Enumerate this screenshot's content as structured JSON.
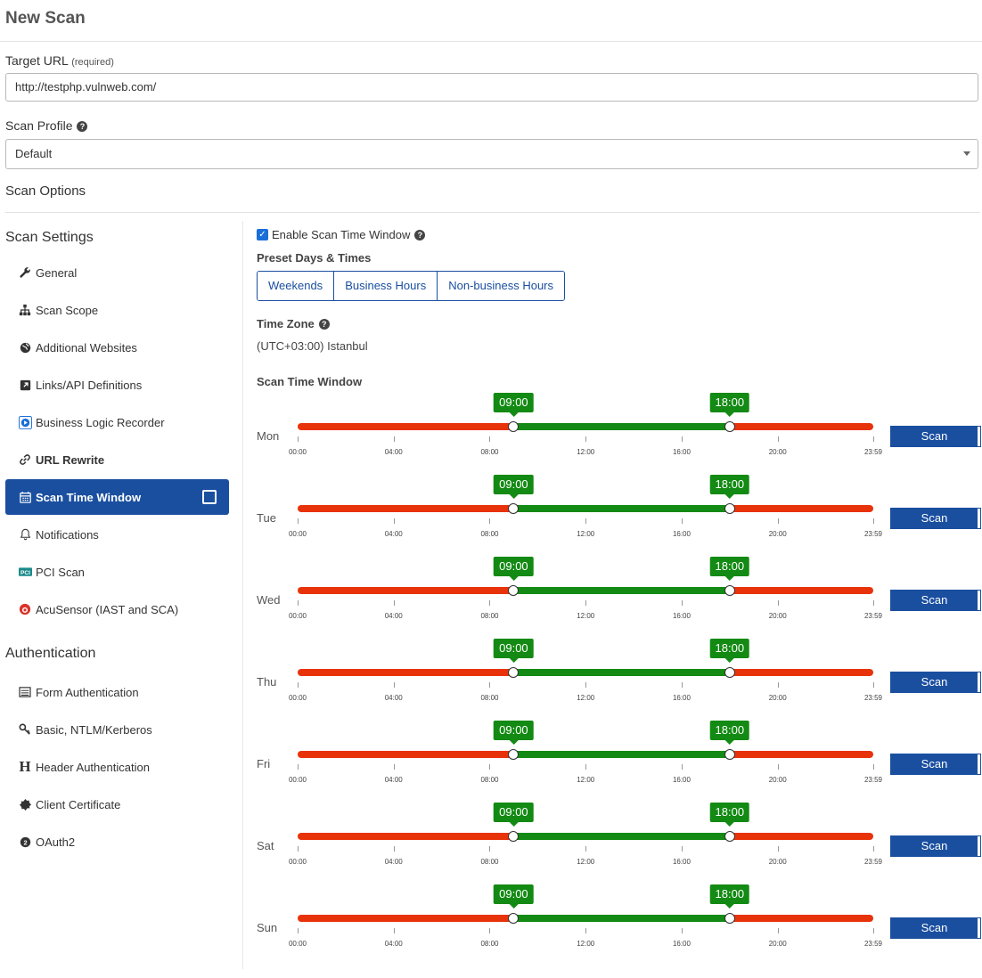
{
  "page_title": "New Scan",
  "target_url": {
    "label": "Target URL",
    "required_note": "(required)",
    "value": "http://testphp.vulnweb.com/"
  },
  "scan_profile": {
    "label": "Scan Profile",
    "selected": "Default"
  },
  "scan_options_heading": "Scan Options",
  "sidebar": {
    "settings_heading": "Scan Settings",
    "settings_items": [
      {
        "label": "General",
        "icon": "wrench-icon"
      },
      {
        "label": "Scan Scope",
        "icon": "sitemap-icon"
      },
      {
        "label": "Additional Websites",
        "icon": "globe-icon"
      },
      {
        "label": "Links/API Definitions",
        "icon": "external-link-icon"
      },
      {
        "label": "Business Logic Recorder",
        "icon": "record-icon"
      },
      {
        "label": "URL Rewrite",
        "icon": "link-icon"
      },
      {
        "label": "Scan Time Window",
        "icon": "calendar-icon"
      },
      {
        "label": "Notifications",
        "icon": "bell-icon"
      },
      {
        "label": "PCI Scan",
        "icon": "pci-icon"
      },
      {
        "label": "AcuSensor (IAST and SCA)",
        "icon": "acusensor-icon"
      }
    ],
    "auth_heading": "Authentication",
    "auth_items": [
      {
        "label": "Form Authentication",
        "icon": "list-icon"
      },
      {
        "label": "Basic, NTLM/Kerberos",
        "icon": "key-icon"
      },
      {
        "label": "Header Authentication",
        "icon": "header-icon"
      },
      {
        "label": "Client Certificate",
        "icon": "certificate-icon"
      },
      {
        "label": "OAuth2",
        "icon": "oauth-icon"
      }
    ]
  },
  "main": {
    "enable_label": "Enable Scan Time Window",
    "enable_checked": true,
    "preset_heading": "Preset Days & Times",
    "presets": [
      "Weekends",
      "Business Hours",
      "Non-business Hours"
    ],
    "timezone_heading": "Time Zone",
    "timezone_value": "(UTC+03:00) Istanbul",
    "window_heading": "Scan Time Window",
    "tick_labels": [
      "00:00",
      "04:00",
      "08:00",
      "12:00",
      "16:00",
      "20:00",
      "23:59"
    ],
    "days": [
      {
        "day": "Mon",
        "start": "09:00",
        "end": "18:00",
        "action": "Scan"
      },
      {
        "day": "Tue",
        "start": "09:00",
        "end": "18:00",
        "action": "Scan"
      },
      {
        "day": "Wed",
        "start": "09:00",
        "end": "18:00",
        "action": "Scan"
      },
      {
        "day": "Thu",
        "start": "09:00",
        "end": "18:00",
        "action": "Scan"
      },
      {
        "day": "Fri",
        "start": "09:00",
        "end": "18:00",
        "action": "Scan"
      },
      {
        "day": "Sat",
        "start": "09:00",
        "end": "18:00",
        "action": "Scan"
      },
      {
        "day": "Sun",
        "start": "09:00",
        "end": "18:00",
        "action": "Scan"
      }
    ]
  },
  "colors": {
    "accent": "#1a4fa0",
    "active_green": "#138a13",
    "inactive_red": "#e8330a"
  }
}
